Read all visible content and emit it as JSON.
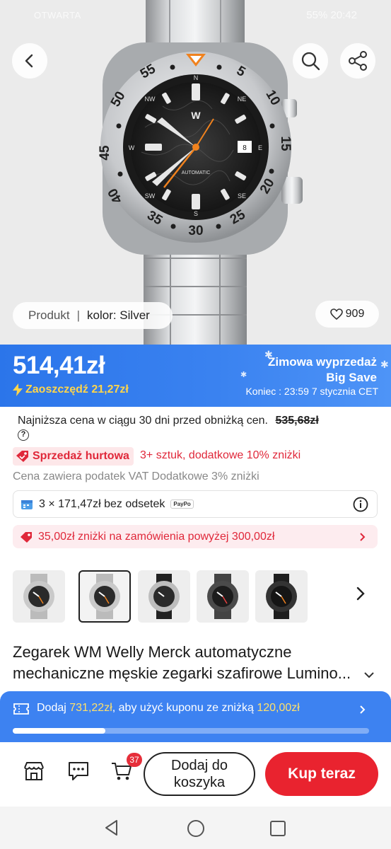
{
  "status_bar": {
    "left": "OTWARTA",
    "right": "55% 20:42"
  },
  "hero": {
    "breadcrumb_label": "Produkt",
    "breadcrumb_sep": "|",
    "color_label": "kolor: Silver",
    "likes": "909",
    "dial_text": "AUTOMATIC"
  },
  "price": {
    "current": "514,41zł",
    "save_label": "Zaoszczędź 21,27zł",
    "promo_title_line1": "Zimowa wyprzedaż",
    "promo_title_line2": "Big Save",
    "promo_end": "Koniec :  23:59 7 stycznia CET"
  },
  "info": {
    "lowest_price_text": "Najniższa cena w ciągu 30 dni przed obniżką cen.",
    "lowest_price_old": "535,68zł",
    "bulk_badge": "Sprzedaż hurtowa",
    "bulk_note": "3+ sztuk, dodatkowe 10% zniżki",
    "vat_note": "Cena zawiera podatek VAT Dodatkowe 3% zniżki",
    "installment": "3 × 171,47zł bez odsetek",
    "paypo": "PayPo",
    "coupon_offer": "35,00zł zniżki na zamówienia powyżej 300,00zł"
  },
  "product": {
    "title": "Zegarek WM Welly Merck automatyczne mechaniczne męskie zegarki szafirowe Lumino..."
  },
  "coupon_bar": {
    "prefix": "Dodaj ",
    "amount": "731,22zł",
    "middle": ", aby użyć kuponu ze zniżką ",
    "discount": "120,00zł",
    "progress": 0.26
  },
  "actions": {
    "cart_badge": "37",
    "add_to_cart": "Dodaj do koszyka",
    "buy_now": "Kup teraz"
  },
  "colors": {
    "accent_blue": "#3d82f1",
    "sale_red": "#e9232f",
    "save_yellow": "#ffd54a",
    "watch_accent": "#f0821e"
  }
}
